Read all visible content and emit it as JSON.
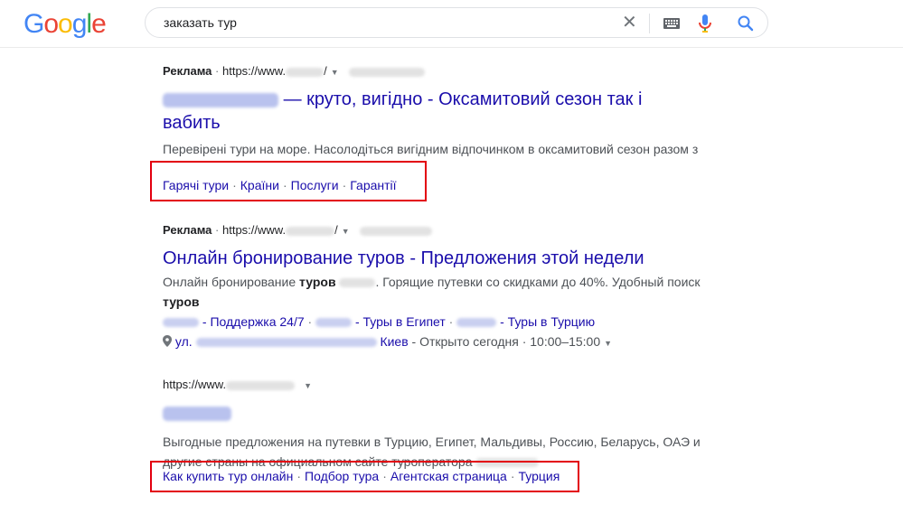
{
  "logo": {
    "letters": [
      "G",
      "o",
      "o",
      "g",
      "l",
      "e"
    ],
    "colors": [
      "#4285f4",
      "#ea4335",
      "#fbbc05",
      "#4285f4",
      "#34a853",
      "#ea4335"
    ]
  },
  "search": {
    "query": "заказать тур",
    "clear_icon": "close-icon",
    "keyboard_icon": "keyboard-icon",
    "mic_icon": "mic-icon",
    "search_icon": "search-icon"
  },
  "results": [
    {
      "ad_label": "Реклама",
      "url": "https://www.",
      "url_tail": "/",
      "title_rest": "— круто, вигідно - Оксамитовий сезон так і вабить",
      "snippet": "Перевірені тури на море. Насолодіться вигідним відпочинком в оксамитовий сезон разом з",
      "sitelinks": [
        "Гарячі тури",
        "Країни",
        "Послуги",
        "Гарантії"
      ]
    },
    {
      "ad_label": "Реклама",
      "url": "https://www.",
      "url_tail": "/",
      "title": "Онлайн бронирование туров - Предложения этой недели",
      "snippet_a": "Онлайн бронирование ",
      "snippet_b": "туров",
      "snippet_c": ". Горящие путевки со скидками до 40%. Удобный поиск",
      "snippet_d": "туров",
      "sitelinks": [
        "- Поддержка 24/7",
        "- Туры в Египет",
        "- Туры в Турцию"
      ],
      "address_prefix": "ул.",
      "city": "Киев",
      "hours": "- Открыто сегодня · 10:00–15:00"
    },
    {
      "url": "https://www.",
      "snippet": "Выгодные предложения на путевки в Турцию, Египет, Мальдивы, Россию, Беларусь, ОАЭ и другие страны на официальном сайте туроператора",
      "sitelinks": [
        "Как купить тур онлайн",
        "Подбор тура",
        "Агентская страница",
        "Турция"
      ]
    }
  ],
  "colors": {
    "link": "#1a0dab",
    "highlight_box": "#e3000f"
  }
}
